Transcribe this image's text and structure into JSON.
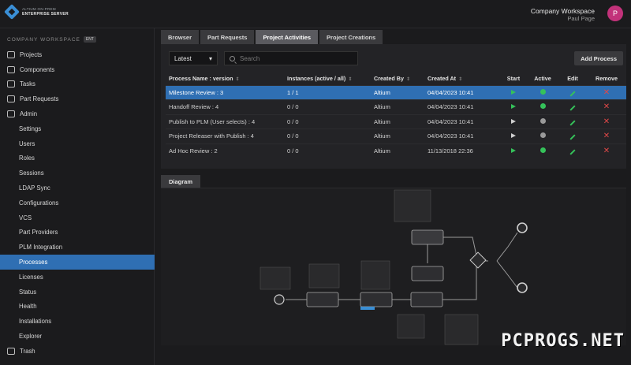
{
  "app": {
    "logo_line1": "ALTIUM ON-PREM",
    "logo_line2": "ENTERPRISE SERVER"
  },
  "account": {
    "workspace": "Company Workspace",
    "user": "Paul Page",
    "avatar_initial": "P"
  },
  "sidebar": {
    "heading": "COMPANY WORKSPACE",
    "heading_badge": "ENT",
    "items": [
      {
        "label": "Projects",
        "sub": false
      },
      {
        "label": "Components",
        "sub": false
      },
      {
        "label": "Tasks",
        "sub": false
      },
      {
        "label": "Part Requests",
        "sub": false
      },
      {
        "label": "Admin",
        "sub": false
      },
      {
        "label": "Settings",
        "sub": true
      },
      {
        "label": "Users",
        "sub": true
      },
      {
        "label": "Roles",
        "sub": true
      },
      {
        "label": "Sessions",
        "sub": true
      },
      {
        "label": "LDAP Sync",
        "sub": true
      },
      {
        "label": "Configurations",
        "sub": true
      },
      {
        "label": "VCS",
        "sub": true
      },
      {
        "label": "Part Providers",
        "sub": true
      },
      {
        "label": "PLM Integration",
        "sub": true
      },
      {
        "label": "Processes",
        "sub": true,
        "active": true
      },
      {
        "label": "Licenses",
        "sub": true
      },
      {
        "label": "Status",
        "sub": true
      },
      {
        "label": "Health",
        "sub": true
      },
      {
        "label": "Installations",
        "sub": true
      },
      {
        "label": "Explorer",
        "sub": true
      },
      {
        "label": "Trash",
        "sub": false
      }
    ]
  },
  "tabs": [
    "Browser",
    "Part Requests",
    "Project Activities",
    "Project Creations"
  ],
  "active_tab": "Project Activities",
  "filters": {
    "version_select": "Latest",
    "search_placeholder": "Search"
  },
  "add_process_label": "Add Process",
  "table": {
    "columns": [
      "Process Name : version",
      "Instances (active / all)",
      "Created By",
      "Created At",
      "Start",
      "Active",
      "Edit",
      "Remove"
    ],
    "rows": [
      {
        "name": "Milestone Review : 3",
        "instances": "1 / 1",
        "created_by": "Altium",
        "created_at": "04/04/2023 10:41",
        "start": "filled",
        "active": true,
        "selected": true
      },
      {
        "name": "Handoff Review : 4",
        "instances": "0 / 0",
        "created_by": "Altium",
        "created_at": "04/04/2023 10:41",
        "start": "filled",
        "active": true,
        "selected": false
      },
      {
        "name": "Publish to PLM (User selects) : 4",
        "instances": "0 / 0",
        "created_by": "Altium",
        "created_at": "04/04/2023 10:41",
        "start": "outline",
        "active": false,
        "selected": false
      },
      {
        "name": "Project Releaser with Publish : 4",
        "instances": "0 / 0",
        "created_by": "Altium",
        "created_at": "04/04/2023 10:41",
        "start": "outline",
        "active": false,
        "selected": false
      },
      {
        "name": "Ad Hoc Review : 2",
        "instances": "0 / 0",
        "created_by": "Altium",
        "created_at": "11/13/2018 22:36",
        "start": "filled",
        "active": true,
        "selected": false
      }
    ]
  },
  "diagram_tab": "Diagram",
  "diagram": {
    "nodes": [
      {
        "id": "start",
        "type": "start"
      },
      {
        "id": "t1",
        "type": "task"
      },
      {
        "id": "t2",
        "type": "task"
      },
      {
        "id": "t3",
        "type": "task"
      },
      {
        "id": "t4",
        "type": "task"
      },
      {
        "id": "t5",
        "type": "task"
      },
      {
        "id": "gw",
        "type": "gateway"
      },
      {
        "id": "end1",
        "type": "end"
      },
      {
        "id": "end2",
        "type": "end"
      }
    ]
  },
  "watermark": "PCPROGS.NET",
  "colors": {
    "accent": "#2f6fb3",
    "active_green": "#35c25a",
    "remove_red": "#e04848",
    "avatar": "#c2327a"
  }
}
